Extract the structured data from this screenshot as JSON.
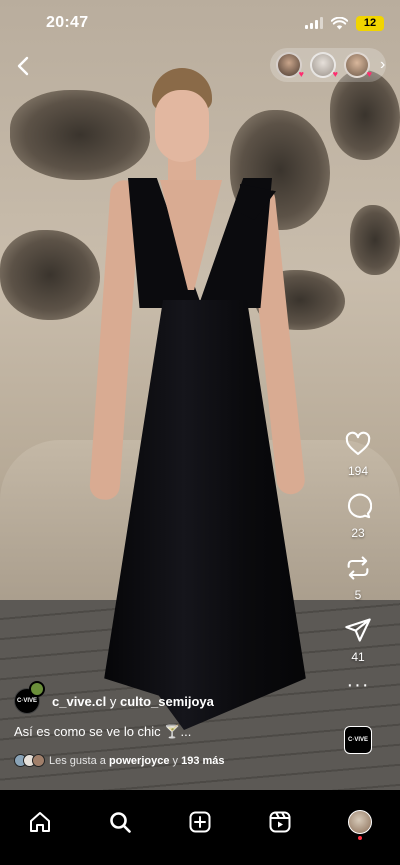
{
  "status_bar": {
    "time": "20:47",
    "battery": "12"
  },
  "reel": {
    "author_primary": "c_vive.cl",
    "author_connector": "y",
    "author_secondary": "culto_semijoya",
    "author_avatar_text": "C·VIVE",
    "caption": "Así es como se ve lo chic 🍸...",
    "likes_prefix": "Les gusta a",
    "likes_user": "powerjoyce",
    "likes_connector": "y",
    "likes_others": "193 más"
  },
  "actions": {
    "likes": "194",
    "comments": "23",
    "reposts": "5",
    "shares": "41",
    "brand_tile_text": "C·VIVE"
  },
  "icons": {
    "back": "chevron-left-icon",
    "like": "heart-icon",
    "comment": "comment-bubble-icon",
    "repost": "repost-icon",
    "share": "paper-plane-icon",
    "more": "more-dots-icon",
    "home": "home-icon",
    "search": "search-icon",
    "create": "plus-square-icon",
    "reels": "reels-icon"
  },
  "colors": {
    "accent_heart": "#ff2d6f",
    "battery": "#f1d500",
    "notification_dot": "#ff3040"
  }
}
